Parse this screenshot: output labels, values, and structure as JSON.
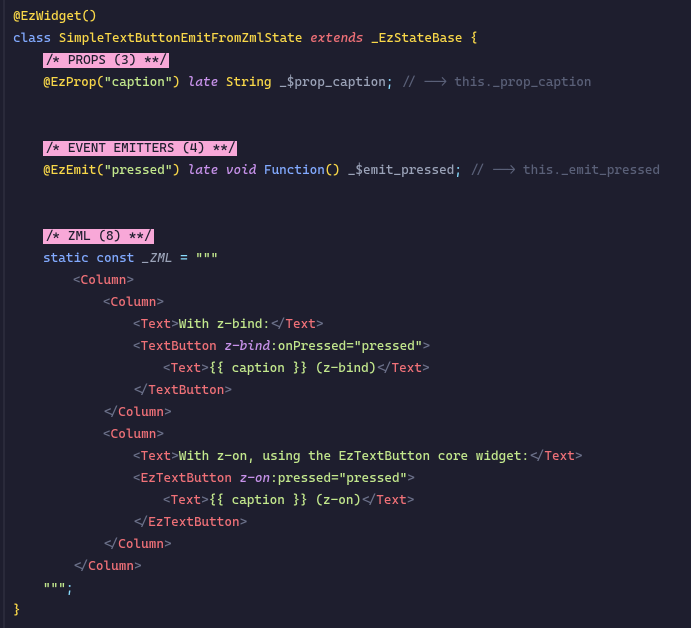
{
  "code": {
    "l0": {
      "annotation": "@EzWidget",
      "p1": "(",
      "p2": ")"
    },
    "l1": {
      "kw_class": "class",
      "name": "SimpleTextButtonEmitFromZmlState",
      "kw_extends": "extends",
      "base": "_EzStateBase",
      "brace": " {"
    },
    "l2": {
      "section": "/* PROPS (3) **/"
    },
    "l3": {
      "ann": "@EzProp",
      "p1": "(",
      "str": "\"caption\"",
      "p2": ")",
      "late": " late",
      "type": " String",
      "var": "_$prop_caption",
      "semi": ";",
      "cmt": " // --> this._prop_caption"
    },
    "l4": {
      "section": "/* EVENT EMITTERS (4) **/"
    },
    "l5": {
      "ann": "@EzEmit",
      "p1": "(",
      "str": "\"pressed\"",
      "p2": ")",
      "late": " late",
      "type": " void",
      "fn": " Function",
      "pp": "()",
      "var": "_$emit_pressed",
      "semi": ";",
      "cmt": " // --> this._emit_pressed"
    },
    "l6": {
      "section": "/* ZML (8) **/"
    },
    "l7": {
      "kw_static": "static",
      "kw_const": " const",
      "var": " _ZML",
      "eq": " = ",
      "q": "\"\"\""
    },
    "l8": {
      "t": "<Column>"
    },
    "l9": {
      "t": "<Column>"
    },
    "l10": {
      "open": "<Text>",
      "txt": "With z-bind:",
      "close": "</Text>"
    },
    "l11": {
      "open": "<TextButton ",
      "attr": "z-bind",
      "colon": ":onPressed=",
      "val": "\"pressed\"",
      "end": ">"
    },
    "l12": {
      "open": "<Text>",
      "txt": "{{ caption }} (z-bind)",
      "close": "</Text>"
    },
    "l13": {
      "t": "</TextButton>"
    },
    "l14": {
      "t": "</Column>"
    },
    "l15": {
      "t": "<Column>"
    },
    "l16": {
      "open": "<Text>",
      "txt": "With z-on, using the EzTextButton core widget:",
      "close": "</Text>"
    },
    "l17": {
      "open": "<EzTextButton ",
      "attr": "z-on",
      "colon": ":pressed=",
      "val": "\"pressed\"",
      "end": ">"
    },
    "l18": {
      "open": "<Text>",
      "txt": "{{ caption }} (z-on)",
      "close": "</Text>"
    },
    "l19": {
      "t": "</EzTextButton>"
    },
    "l20": {
      "t": "</Column>"
    },
    "l21": {
      "t": "</Column>"
    },
    "l22": {
      "q": "\"\"\"",
      "semi": ";"
    },
    "l23": {
      "brace": "}"
    }
  }
}
